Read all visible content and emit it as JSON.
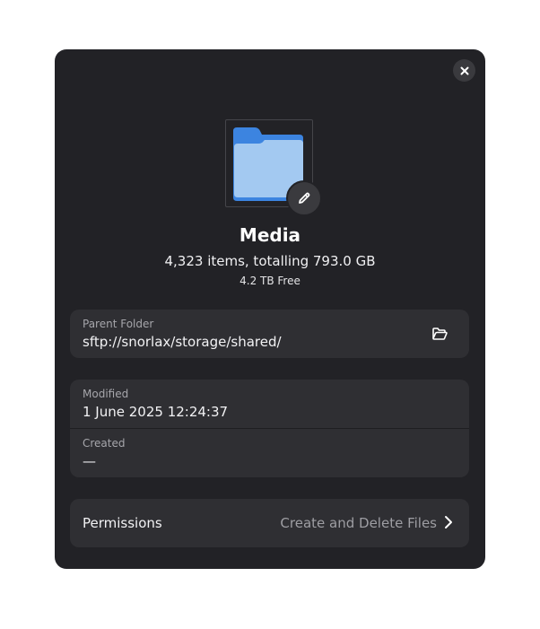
{
  "folder": {
    "name": "Media",
    "summary": "4,323 items, totalling 793.0 GB",
    "free_space": "4.2 TB Free"
  },
  "parent_folder": {
    "label": "Parent Folder",
    "value": "sftp://snorlax/storage/shared/"
  },
  "dates": {
    "modified_label": "Modified",
    "modified_value": "1 June 2025 12:24:37",
    "created_label": "Created",
    "created_value": "—"
  },
  "permissions": {
    "label": "Permissions",
    "value": "Create and Delete Files"
  },
  "icons": {
    "close": "close-icon",
    "folder": "folder-icon",
    "edit": "pencil-icon",
    "open_folder": "folder-open-icon",
    "chevron": "chevron-right-icon"
  },
  "colors": {
    "dialog_bg": "#222226",
    "card_bg": "#2f2f33",
    "folder_back": "#3c84e0",
    "folder_front": "#a3c9f1"
  }
}
